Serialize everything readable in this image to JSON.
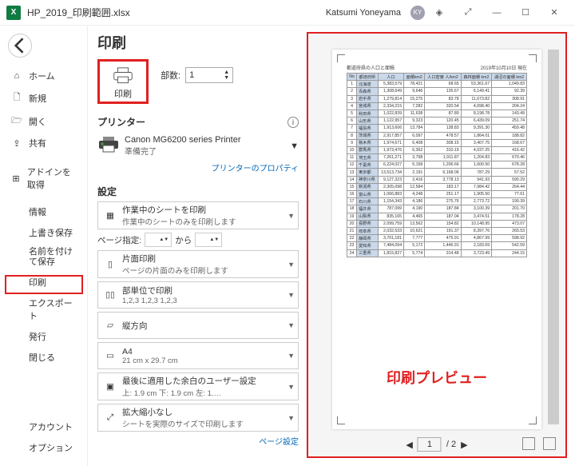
{
  "titlebar": {
    "filename": "HP_2019_印刷範囲.xlsx",
    "username": "Katsumi Yoneyama",
    "initials": "KY"
  },
  "sidebar": {
    "home": "ホーム",
    "new": "新規",
    "open": "開く",
    "share": "共有",
    "addins": "アドインを取得",
    "info": "情報",
    "save_over": "上書き保存",
    "save_as": "名前を付けて保存",
    "print": "印刷",
    "export": "エクスポート",
    "publish": "発行",
    "close": "閉じる",
    "account": "アカウント",
    "options": "オプション"
  },
  "content": {
    "title": "印刷",
    "print_btn": "印刷",
    "copies_label": "部数:",
    "copies_value": "1",
    "printer_heading": "プリンター",
    "printer_name": "Canon MG6200 series Printer",
    "printer_status": "準備完了",
    "printer_props": "プリンターのプロパティ",
    "settings_heading": "設定",
    "setting_scope_main": "作業中のシートを印刷",
    "setting_scope_sub": "作業中のシートのみを印刷します",
    "page_range_label": "ページ指定:",
    "page_range_to": "から",
    "setting_side_main": "片面印刷",
    "setting_side_sub": "ページの片面のみを印刷します",
    "setting_collate_main": "部単位で印刷",
    "setting_collate_sub": "1,2,3   1,2,3   1,2,3",
    "setting_orient": "縦方向",
    "setting_paper_main": "A4",
    "setting_paper_sub": "21 cm x 29.7 cm",
    "setting_margin_main": "最後に適用した余白のユーザー設定",
    "setting_margin_sub": "上: 1.9 cm 下: 1.9 cm 左: 1.…",
    "setting_scale_main": "拡大縮小なし",
    "setting_scale_sub": "シートを実際のサイズで印刷します",
    "page_setup_link": "ページ設定"
  },
  "preview": {
    "label": "印刷プレビュー",
    "table_title": "都道府県の人口と面積",
    "table_date": "2019年10月10日 現在",
    "page_current": "1",
    "page_total": "/ 2",
    "cols": [
      "No",
      "都道府県",
      "人口",
      "面積km2",
      "人口密度 人/km2",
      "森林面積 km2",
      "湖沼の面積 km2"
    ],
    "rows": [
      [
        "1",
        "北海道",
        "5,383,579",
        "78,421",
        "68.65",
        "53,361.67",
        "1,049.83"
      ],
      [
        "2",
        "青森県",
        "1,308,649",
        "9,646",
        "135.67",
        "6,149.41",
        "92.39"
      ],
      [
        "3",
        "岩手県",
        "1,279,814",
        "15,275",
        "83.78",
        "11,673.82",
        "308.91"
      ],
      [
        "4",
        "宮城県",
        "2,334,215",
        "7,282",
        "320.54",
        "4,098.40",
        "204.24"
      ],
      [
        "5",
        "秋田県",
        "1,022,839",
        "11,638",
        "87.89",
        "8,198.78",
        "143.49"
      ],
      [
        "6",
        "山形県",
        "1,122,957",
        "9,323",
        "120.45",
        "6,439.09",
        "251.74"
      ],
      [
        "7",
        "福島県",
        "1,913,606",
        "13,784",
        "138.83",
        "9,391.30",
        "459.48"
      ],
      [
        "8",
        "茨城県",
        "2,917,857",
        "6,097",
        "478.57",
        "1,864.01",
        "188.82"
      ],
      [
        "9",
        "栃木県",
        "1,974,671",
        "6,408",
        "308.15",
        "3,407.75",
        "168.67"
      ],
      [
        "10",
        "群馬県",
        "1,973,476",
        "6,362",
        "310.19",
        "4,037.25",
        "416.42"
      ],
      [
        "11",
        "埼玉県",
        "7,261,271",
        "3,798",
        "1,911.87",
        "1,204.83",
        "670.46"
      ],
      [
        "12",
        "千葉県",
        "6,224,027",
        "5,158",
        "1,206.66",
        "1,600.50",
        "678.28"
      ],
      [
        "13",
        "東京都",
        "13,513,734",
        "2,191",
        "6,168.06",
        "787.29",
        "57.52"
      ],
      [
        "14",
        "神奈川県",
        "9,127,323",
        "2,416",
        "3,778.13",
        "941.93",
        "590.29"
      ],
      [
        "15",
        "新潟県",
        "2,305,098",
        "12,584",
        "183.17",
        "7,984.42",
        "264.44"
      ],
      [
        "16",
        "富山県",
        "1,066,883",
        "4,248",
        "251.17",
        "1,905.50",
        "77.61"
      ],
      [
        "17",
        "石川県",
        "1,154,343",
        "4,186",
        "275.76",
        "2,773.72",
        "190.39"
      ],
      [
        "18",
        "福井県",
        "787,099",
        "4,190",
        "187.84",
        "3,100.39",
        "201.70"
      ],
      [
        "19",
        "山梨県",
        "835,165",
        "4,465",
        "187.04",
        "3,474.51",
        "178.28"
      ],
      [
        "20",
        "長野県",
        "2,099,759",
        "13,562",
        "154.82",
        "10,148.95",
        "473.07"
      ],
      [
        "21",
        "岐阜県",
        "2,032,533",
        "10,621",
        "191.37",
        "8,397.76",
        "265.53"
      ],
      [
        "22",
        "静岡県",
        "3,701,181",
        "7,777",
        "475.91",
        "4,867.99",
        "598.92"
      ],
      [
        "23",
        "愛知県",
        "7,484,094",
        "5,172",
        "1,446.91",
        "2,183.69",
        "542.59"
      ],
      [
        "24",
        "三重県",
        "1,815,827",
        "5,774",
        "314.48",
        "3,723.49",
        "244.15"
      ]
    ]
  }
}
